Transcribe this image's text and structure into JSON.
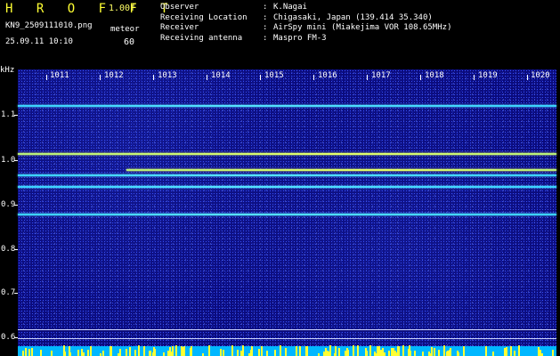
{
  "header": {
    "brand": "H R O F F T",
    "version": "1.00f",
    "filename": "KN9_2509111010.png",
    "datetime": "25.09.11 10:10",
    "meteor_label": "meteor",
    "meteor_count": "60",
    "info": [
      {
        "key": "Observer",
        "value": "K.Nagai"
      },
      {
        "key": "Receiving Location",
        "value": "Chigasaki, Japan (139.414 35.340)"
      },
      {
        "key": "Receiver",
        "value": "AirSpy mini (Miakejima VOR 108.65MHz)"
      },
      {
        "key": "Receiving antenna",
        "value": "Maspro FM-3"
      }
    ]
  },
  "plot": {
    "unit_label": "kHz",
    "x_ticks": [
      "1011",
      "1012",
      "1013",
      "1014",
      "1015",
      "1016",
      "1017",
      "1018",
      "1019",
      "1020"
    ],
    "y_ticks": [
      "1.1",
      "1.0",
      "0.9",
      "0.8",
      "0.7",
      "0.6"
    ],
    "colors": {
      "background": "#0a0a7a",
      "signal": "#56e3ff",
      "bottom_bar": "#00b7ff",
      "activity": "#ffff33"
    }
  }
}
